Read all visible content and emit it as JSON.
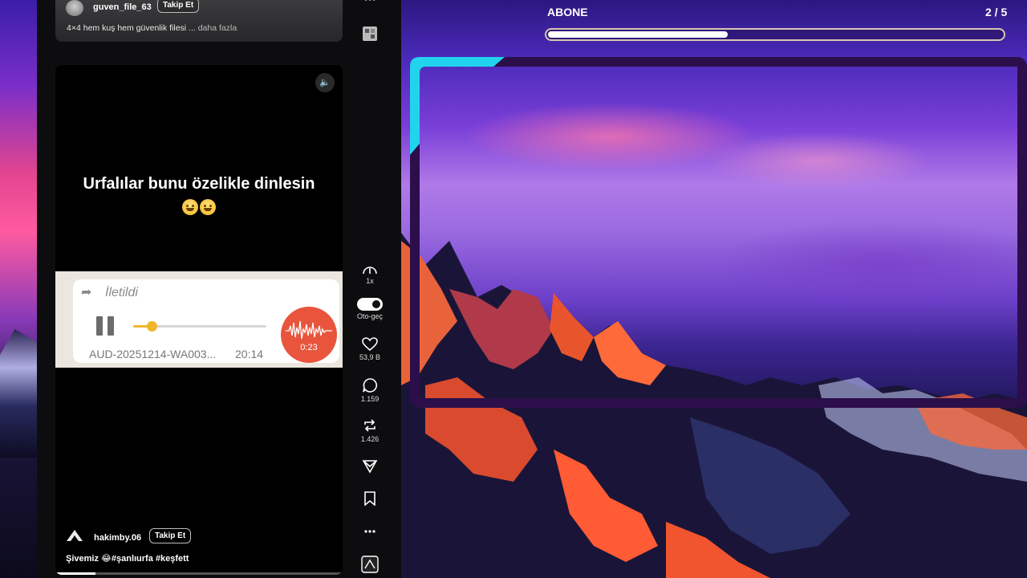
{
  "previous_post": {
    "username": "guven_file_63",
    "follow_label": "Takip Et",
    "caption": "4×4 hem kuş hem güvenlik filesi ...",
    "more_label": "daha fazla"
  },
  "video": {
    "title_text": "Urfalılar bunu özelikle dinlesin",
    "voice_message": {
      "forwarded_label": "İletildi",
      "file_name": "AUD-20251214-WA003...",
      "time": "20:14",
      "duration": "0:23",
      "progress_fraction": 0.14
    },
    "owner": {
      "username": "hakimby.06",
      "follow_label": "Takip Et",
      "caption": "Şivemiz 😂#şanlıurfa #keşfett"
    },
    "playback_progress_fraction": 0.14
  },
  "actions": {
    "speed_label": "1x",
    "autoplay_label": "Oto-geç",
    "likes": "53,9 B",
    "comments": "1.159",
    "reposts": "1.426"
  },
  "overlay": {
    "title": "ABONE",
    "counter": "2 / 5",
    "progress_fraction": 0.4,
    "accent_color": "#22d3ee",
    "frame_color": "#2c0e4a"
  }
}
